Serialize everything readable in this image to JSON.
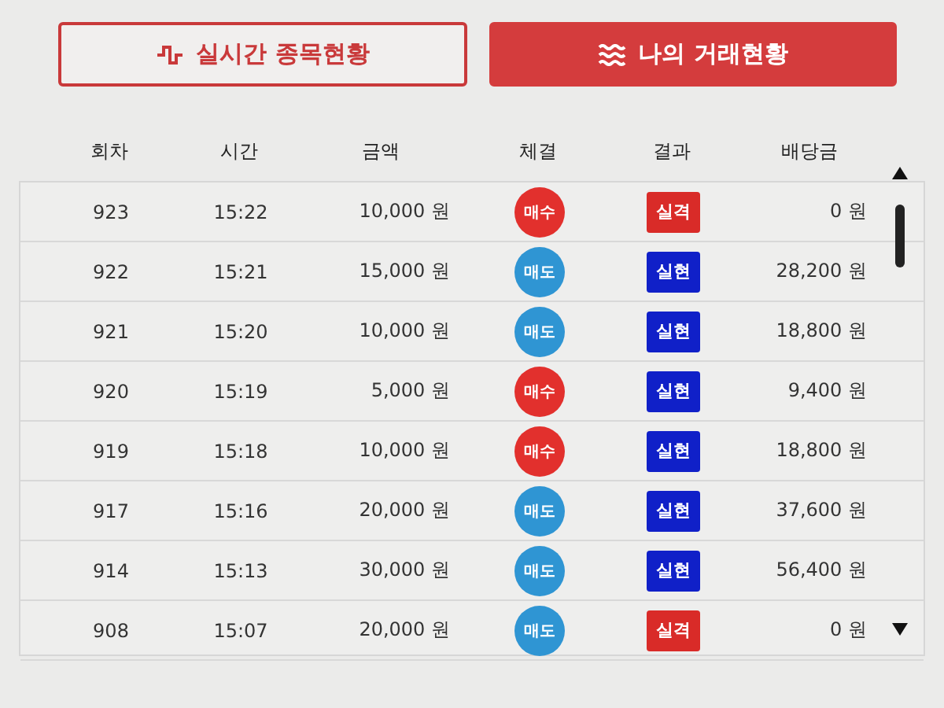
{
  "tabs": [
    {
      "label": "실시간 종목현황",
      "selected": false
    },
    {
      "label": "나의 거래현황",
      "selected": true
    }
  ],
  "table": {
    "columns": [
      "회차",
      "시간",
      "금액",
      "체결",
      "결과",
      "배당금"
    ],
    "rows": [
      {
        "round": "923",
        "time": "15:22",
        "amount": "10,000 원",
        "trade": {
          "kind": "buy",
          "label": "매수"
        },
        "result": {
          "kind": "lose",
          "label": "실격"
        },
        "payout": "0 원"
      },
      {
        "round": "922",
        "time": "15:21",
        "amount": "15,000 원",
        "trade": {
          "kind": "sell",
          "label": "매도"
        },
        "result": {
          "kind": "win",
          "label": "실현"
        },
        "payout": "28,200 원"
      },
      {
        "round": "921",
        "time": "15:20",
        "amount": "10,000 원",
        "trade": {
          "kind": "sell",
          "label": "매도"
        },
        "result": {
          "kind": "win",
          "label": "실현"
        },
        "payout": "18,800 원"
      },
      {
        "round": "920",
        "time": "15:19",
        "amount": "5,000 원",
        "trade": {
          "kind": "buy",
          "label": "매수"
        },
        "result": {
          "kind": "win",
          "label": "실현"
        },
        "payout": "9,400 원"
      },
      {
        "round": "919",
        "time": "15:18",
        "amount": "10,000 원",
        "trade": {
          "kind": "buy",
          "label": "매수"
        },
        "result": {
          "kind": "win",
          "label": "실현"
        },
        "payout": "18,800 원"
      },
      {
        "round": "917",
        "time": "15:16",
        "amount": "20,000 원",
        "trade": {
          "kind": "sell",
          "label": "매도"
        },
        "result": {
          "kind": "win",
          "label": "실현"
        },
        "payout": "37,600 원"
      },
      {
        "round": "914",
        "time": "15:13",
        "amount": "30,000 원",
        "trade": {
          "kind": "sell",
          "label": "매도"
        },
        "result": {
          "kind": "win",
          "label": "실현"
        },
        "payout": "56,400 원"
      },
      {
        "round": "908",
        "time": "15:07",
        "amount": "20,000 원",
        "trade": {
          "kind": "sell",
          "label": "매도"
        },
        "result": {
          "kind": "lose",
          "label": "실격"
        },
        "payout": "0 원"
      }
    ]
  }
}
